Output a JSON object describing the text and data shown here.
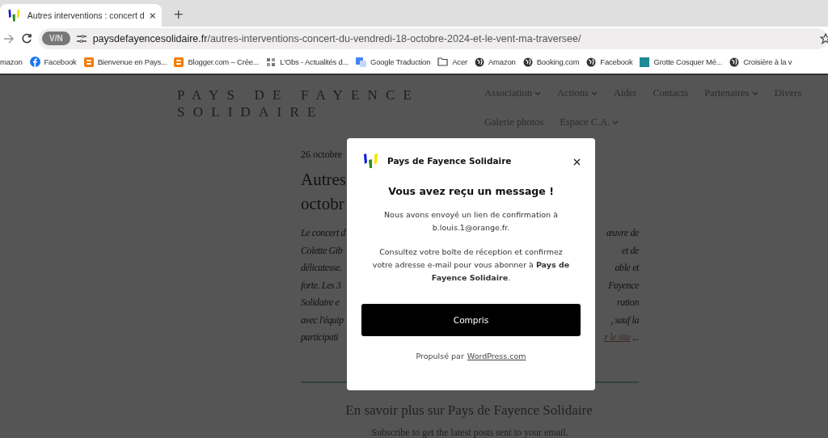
{
  "browser": {
    "tab": {
      "title": "Autres interventions : concert d",
      "selected": true
    },
    "new_tab": "+",
    "address": {
      "badge": "V/N",
      "url_domain": "paysdefayencesolidaire.fr",
      "url_path": "/autres-interventions-concert-du-vendredi-18-octobre-2024-et-le-vent-ma-traversee/"
    },
    "bookmarks": [
      {
        "label": "mazon",
        "kind": "none"
      },
      {
        "label": "Facebook",
        "kind": "facebook"
      },
      {
        "label": "Bienvenue en Pays...",
        "kind": "blogger"
      },
      {
        "label": "Blogger.com – Crée...",
        "kind": "blogger"
      },
      {
        "label": "L'Obs - Actualités d...",
        "kind": "news"
      },
      {
        "label": "Google Traduction",
        "kind": "translate"
      },
      {
        "label": "Acer",
        "kind": "folder"
      },
      {
        "label": "Amazon",
        "kind": "globe"
      },
      {
        "label": "Booking.com",
        "kind": "globe"
      },
      {
        "label": "Facebook",
        "kind": "globe"
      },
      {
        "label": "Grotte Cosquer Mé...",
        "kind": "image"
      },
      {
        "label": "Croisière à la v",
        "kind": "globe"
      }
    ]
  },
  "site": {
    "title": "PAYS DE FAYENCE SOLIDAIRE",
    "nav": [
      {
        "label": "Association",
        "dropdown": true
      },
      {
        "label": "Actions",
        "dropdown": true
      },
      {
        "label": "Aider",
        "dropdown": false
      },
      {
        "label": "Contacts",
        "dropdown": false
      },
      {
        "label": "Partenaires",
        "dropdown": true
      },
      {
        "label": "Divers",
        "dropdown": false
      },
      {
        "label": "Galerie photos",
        "dropdown": false
      },
      {
        "label": "Espace C.A.",
        "dropdown": true
      }
    ],
    "post": {
      "date": "26 octobre",
      "title_lines": [
        "Autres",
        "octobr"
      ],
      "lines": [
        {
          "left": "Le concert d",
          "right": "œuvre de"
        },
        {
          "left": "Colette Gib",
          "right": "et de"
        },
        {
          "left": "délicatesse.",
          "right": "able et"
        },
        {
          "left": "forte. Les 3",
          "right": "Fayence"
        },
        {
          "left": "Solidaire e",
          "right": "ration"
        },
        {
          "left": "avec l'équip",
          "right": ", sauf la"
        },
        {
          "left": "participati",
          "right": "r le site",
          "right_suffix": " ..."
        }
      ]
    },
    "subscribe": {
      "heading": "En savoir plus sur Pays de Fayence Solidaire",
      "text": "Subscribe to get the latest posts sent to your email."
    }
  },
  "modal": {
    "brand": "Pays de Fayence Solidaire",
    "title": "Vous avez reçu un message !",
    "paragraphs": [
      "Nous avons envoyé un lien de confirmation à b.louis.1@orange.fr.",
      "Consultez votre boîte de réception et confirmez votre adresse e-mail pour vous abonner à **Pays de Fayence Solidaire**."
    ],
    "button": "Compris",
    "footer_text": "Propulsé par",
    "footer_link": "WordPress.com"
  }
}
